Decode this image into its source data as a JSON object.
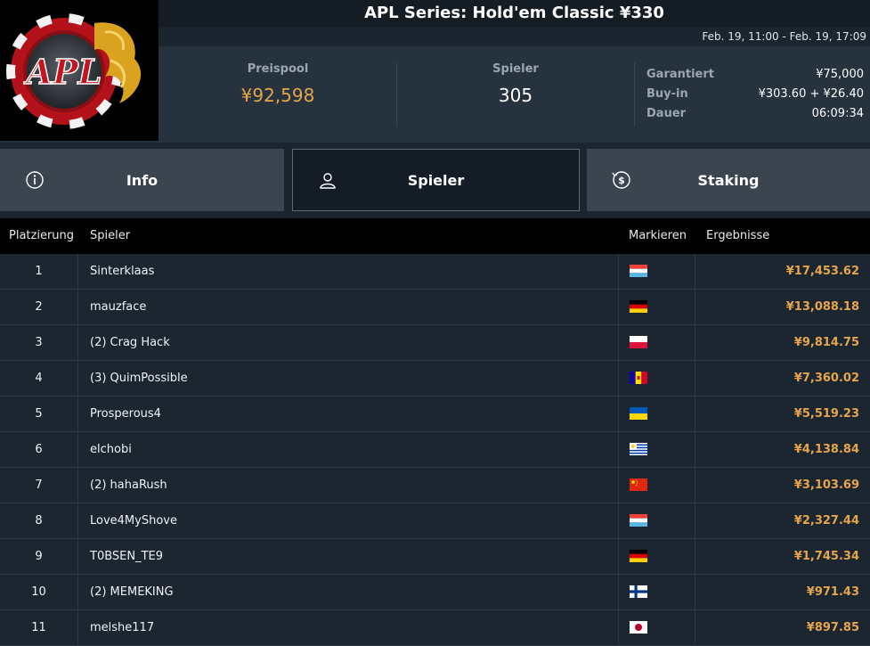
{
  "header": {
    "title": "APL Series: Hold'em Classic ¥330",
    "date_range": "Feb. 19, 11:00 - Feb. 19, 17:09",
    "logo_text": "APL",
    "prize_pool_label": "Preispool",
    "prize_pool_value": "¥92,598",
    "players_label": "Spieler",
    "players_value": "305",
    "details": [
      {
        "key": "Garantiert",
        "value": "¥75,000"
      },
      {
        "key": "Buy-in",
        "value": "¥303.60 + ¥26.40"
      },
      {
        "key": "Dauer",
        "value": "06:09:34"
      }
    ]
  },
  "tabs": [
    {
      "label": "Info",
      "icon": "info-icon",
      "active": false
    },
    {
      "label": "Spieler",
      "icon": "user-icon",
      "active": true
    },
    {
      "label": "Staking",
      "icon": "dollar-coin-icon",
      "active": false
    }
  ],
  "table": {
    "columns": {
      "place": "Platzierung",
      "player": "Spieler",
      "mark": "Markieren",
      "results": "Ergebnisse"
    },
    "rows": [
      {
        "place": "1",
        "name": "Sinterklaas",
        "flag": "luxembourg",
        "result": "¥17,453.62"
      },
      {
        "place": "2",
        "name": "mauzface",
        "flag": "germany",
        "result": "¥13,088.18"
      },
      {
        "place": "3",
        "name": "(2) Crag Hack",
        "flag": "poland",
        "result": "¥9,814.75"
      },
      {
        "place": "4",
        "name": "(3) QuimPossible",
        "flag": "andorra",
        "result": "¥7,360.02"
      },
      {
        "place": "5",
        "name": "Prosperous4",
        "flag": "ukraine",
        "result": "¥5,519.23"
      },
      {
        "place": "6",
        "name": "elchobi",
        "flag": "uruguay",
        "result": "¥4,138.84"
      },
      {
        "place": "7",
        "name": "(2) hahaRush",
        "flag": "china",
        "result": "¥3,103.69"
      },
      {
        "place": "8",
        "name": "Love4MyShove",
        "flag": "luxembourg",
        "result": "¥2,327.44"
      },
      {
        "place": "9",
        "name": "T0BSEN_TE9",
        "flag": "germany",
        "result": "¥1,745.34"
      },
      {
        "place": "10",
        "name": "(2) MEMEKING",
        "flag": "finland",
        "result": "¥971.43"
      },
      {
        "place": "11",
        "name": "melshe117",
        "flag": "japan",
        "result": "¥897.85"
      }
    ]
  },
  "colors": {
    "accent": "#e5a54a",
    "background": "#1b2530",
    "header": "#26323d",
    "tab": "#3a4550",
    "tab_active": "#141d26"
  }
}
